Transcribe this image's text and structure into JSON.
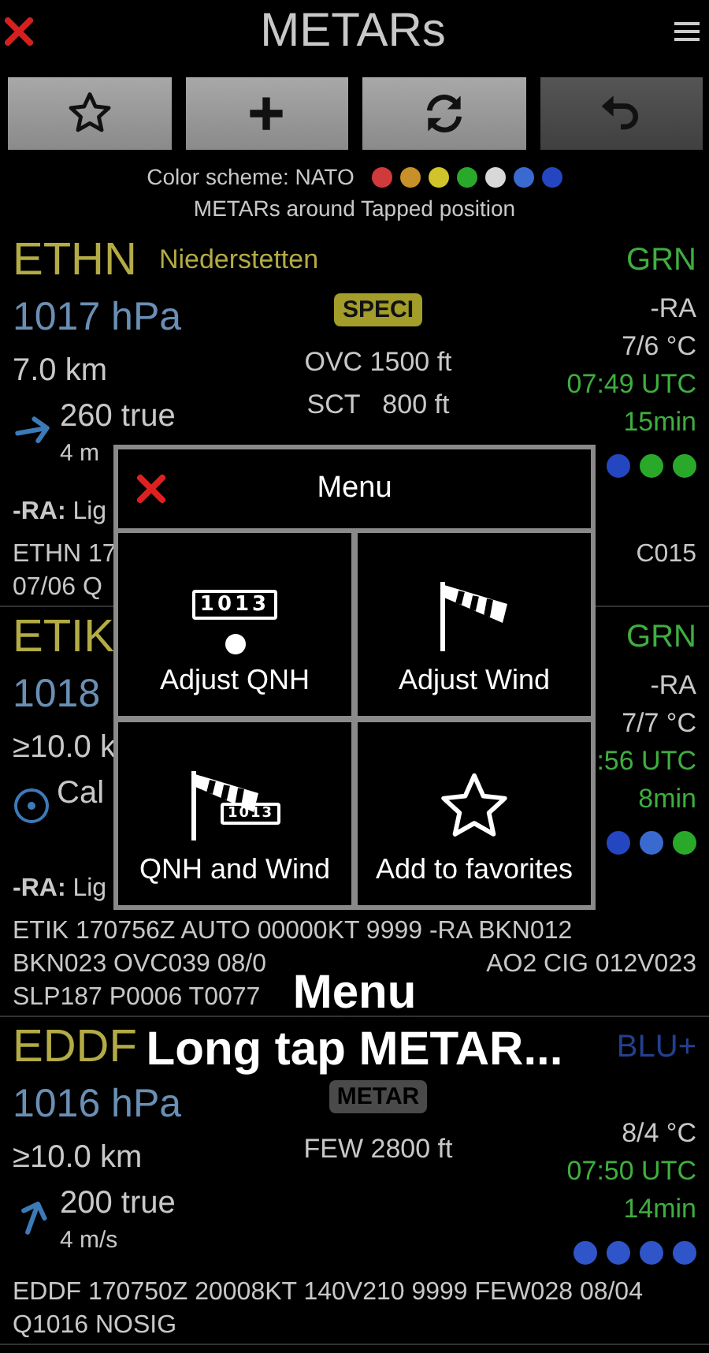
{
  "header": {
    "title": "METARs"
  },
  "toolbar": [
    {
      "kind": "favorites",
      "disabled": false
    },
    {
      "kind": "add",
      "disabled": false
    },
    {
      "kind": "refresh",
      "disabled": false
    },
    {
      "kind": "undo",
      "disabled": true
    }
  ],
  "color_scheme": {
    "label": "Color scheme: NATO",
    "dots": [
      {
        "color": "#d03a3a"
      },
      {
        "color": "#c8902a"
      },
      {
        "color": "#d0c42a"
      },
      {
        "color": "#2aa82a"
      },
      {
        "color": "#d8d8d8"
      },
      {
        "color": "#3a6ad0"
      },
      {
        "color": "#2446c0"
      }
    ]
  },
  "subtitle": "METARs around Tapped position",
  "stations": [
    {
      "code": "ETHN",
      "name": "Niederstetten",
      "category": {
        "label": "GRN",
        "color": "#3fae3f"
      },
      "pressure": "1017 hPa",
      "badge": {
        "kind": "speci",
        "label": "SPECI"
      },
      "visibility": "7.0 km",
      "clouds": [
        "OVC 1500 ft",
        "SCT   800 ft"
      ],
      "weather": "-RA",
      "temperature": "7/6 °C",
      "time": "07:49 UTC",
      "age": "15min",
      "wind": {
        "kind": "arrow",
        "direction": "260 true",
        "speed": "4 m"
      },
      "dots": [
        {
          "color": "#2446c0"
        },
        {
          "color": "#2aa82a"
        },
        {
          "color": "#2aa82a"
        }
      ],
      "description": {
        "code": "-RA:",
        "text": "Lig"
      },
      "raw": [
        {
          "left": "ETHN 17",
          "right": "C015"
        },
        {
          "left": "07/06 Q"
        }
      ]
    },
    {
      "code": "ETIK",
      "category": {
        "label": "GRN",
        "color": "#3fae3f"
      },
      "pressure": "1018",
      "visibility": "≥10.0 k",
      "weather": "-RA",
      "temperature": "7/7 °C",
      "time": ":56 UTC",
      "age": "8min",
      "wind": {
        "kind": "calm",
        "direction": "Cal"
      },
      "dots": [
        {
          "color": "#2446c0"
        },
        {
          "color": "#3a6ad0"
        },
        {
          "color": "#2aa82a"
        }
      ],
      "description": {
        "code": "-RA:",
        "text": "Lig"
      },
      "raw": [
        {
          "left": "ETIK 170756Z AUTO 00000KT 9999 -RA BKN012"
        },
        {
          "left": "BKN023 OVC039 08/0",
          "right": "AO2 CIG 012V023"
        },
        {
          "left": "SLP187 P0006 T0077"
        }
      ]
    },
    {
      "code": "EDDF",
      "category": {
        "label": "BLU+",
        "color": "#23408f"
      },
      "pressure": "1016 hPa",
      "badge": {
        "kind": "metar",
        "label": "METAR"
      },
      "visibility": "≥10.0 km",
      "clouds": [
        "FEW 2800 ft"
      ],
      "temperature": "8/4 °C",
      "time": "07:50 UTC",
      "age": "14min",
      "wind": {
        "kind": "arrow",
        "direction": "200 true",
        "speed": "4 m/s"
      },
      "dots": [
        {
          "color": "#2f55c8"
        },
        {
          "color": "#2f55c8"
        },
        {
          "color": "#2f55c8"
        },
        {
          "color": "#2f55c8"
        }
      ],
      "raw": [
        {
          "left": "EDDF 170750Z 20008KT 140V210 9999 FEW028 08/04"
        },
        {
          "left": "Q1016 NOSIG"
        }
      ]
    }
  ],
  "menu": {
    "title": "Menu",
    "items": [
      {
        "kind": "qnh",
        "label": "Adjust QNH",
        "display": "1013"
      },
      {
        "kind": "wind",
        "label": "Adjust Wind"
      },
      {
        "kind": "both",
        "label": "QNH and Wind",
        "display": "1013"
      },
      {
        "kind": "favorite",
        "label": "Add to favorites"
      }
    ]
  },
  "caption": [
    "Menu",
    "Long tap METAR..."
  ]
}
